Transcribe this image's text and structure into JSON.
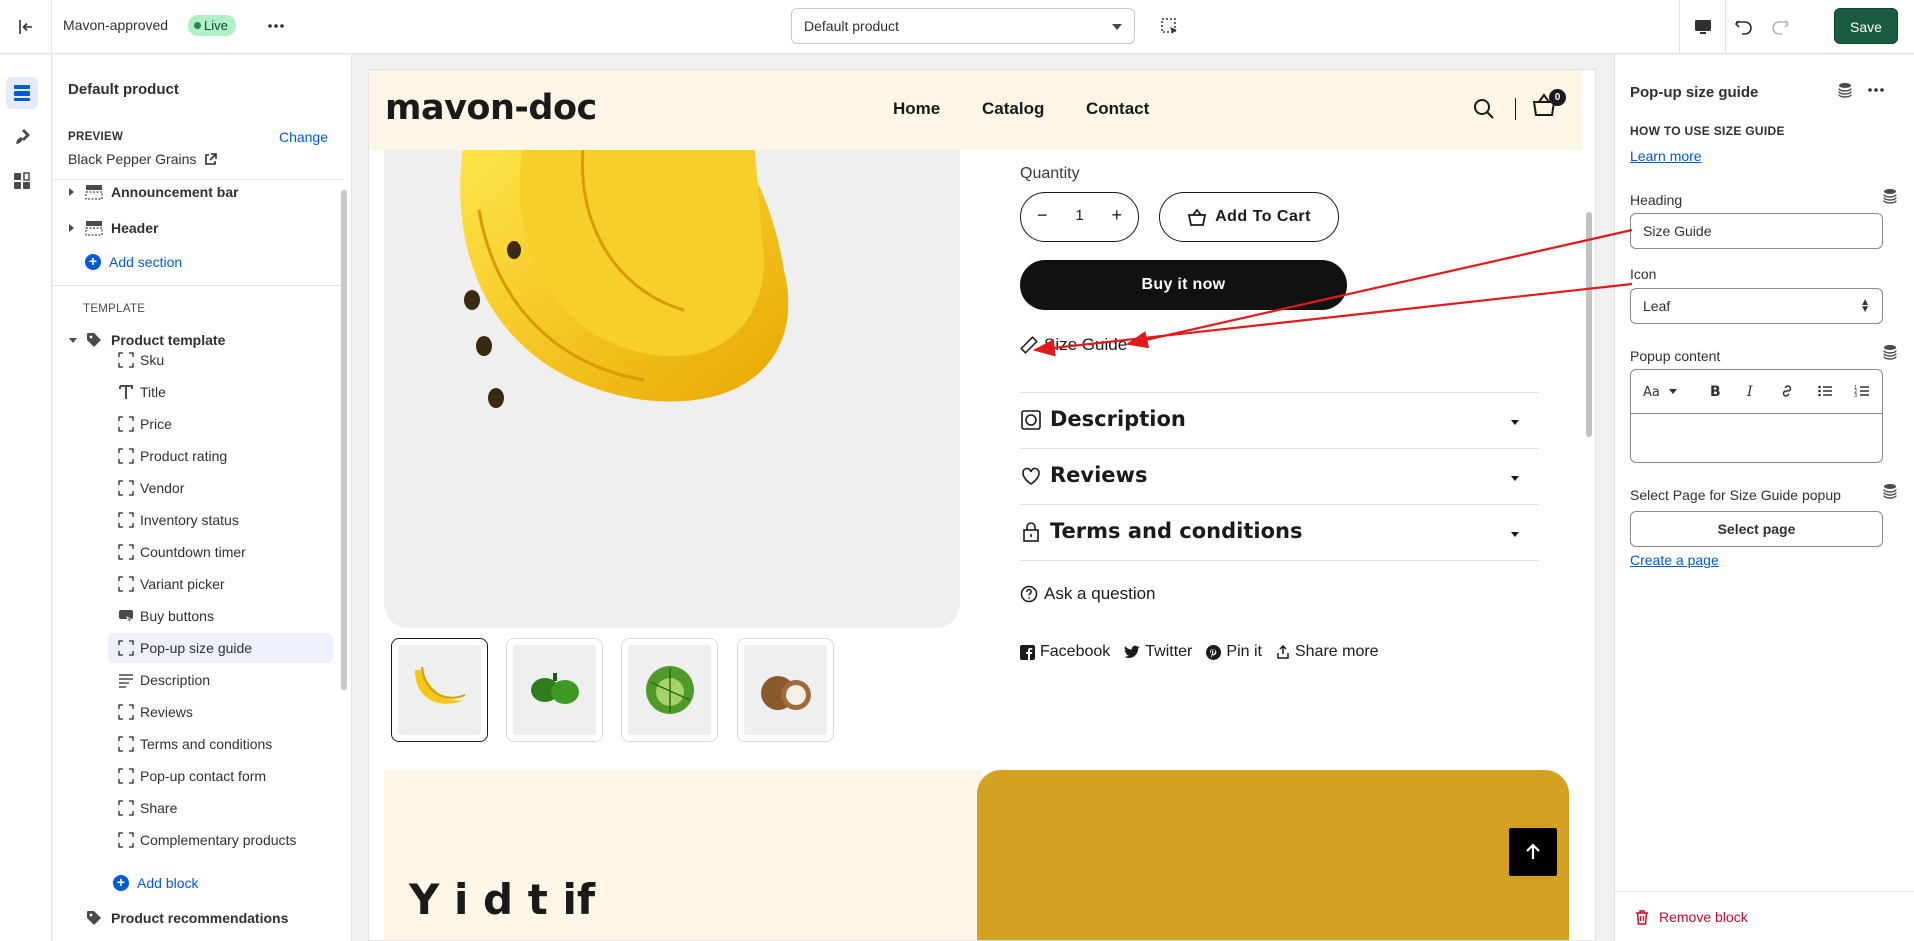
{
  "topbar": {
    "store_name": "Mavon-approved",
    "live_badge": "Live",
    "template_select_value": "Default product",
    "save_label": "Save"
  },
  "left_panel": {
    "title": "Default product",
    "preview_label": "PREVIEW",
    "change_label": "Change",
    "preview_value": "Black Pepper Grains",
    "sections_top": [
      {
        "label": "Announcement bar"
      },
      {
        "label": "Header"
      }
    ],
    "add_section_label": "Add section",
    "template_label": "TEMPLATE",
    "product_template_label": "Product template",
    "blocks": [
      {
        "label": "Sku",
        "icon": "block-frame-icon"
      },
      {
        "label": "Title",
        "icon": "title-t-icon"
      },
      {
        "label": "Price",
        "icon": "block-frame-icon"
      },
      {
        "label": "Product rating",
        "icon": "block-frame-icon"
      },
      {
        "label": "Vendor",
        "icon": "block-frame-icon"
      },
      {
        "label": "Inventory status",
        "icon": "block-frame-icon"
      },
      {
        "label": "Countdown timer",
        "icon": "block-frame-icon"
      },
      {
        "label": "Variant picker",
        "icon": "block-frame-icon"
      },
      {
        "label": "Buy buttons",
        "icon": "buy-buttons-icon"
      },
      {
        "label": "Pop-up size guide",
        "icon": "block-frame-icon",
        "selected": true
      },
      {
        "label": "Description",
        "icon": "text-lines-icon"
      },
      {
        "label": "Reviews",
        "icon": "block-frame-icon"
      },
      {
        "label": "Terms and conditions",
        "icon": "block-frame-icon"
      },
      {
        "label": "Pop-up contact form",
        "icon": "block-frame-icon"
      },
      {
        "label": "Share",
        "icon": "block-frame-icon"
      },
      {
        "label": "Complementary products",
        "icon": "block-frame-icon"
      }
    ],
    "add_block_label": "Add block",
    "product_recommendations_label": "Product recommendations"
  },
  "preview": {
    "logo": "mavon-doc",
    "nav": [
      "Home",
      "Catalog",
      "Contact"
    ],
    "cart_count": "0",
    "quantity_label": "Quantity",
    "quantity_value": "1",
    "qty_minus": "−",
    "qty_plus": "+",
    "add_to_cart": "Add To Cart",
    "buy_now": "Buy it now",
    "size_guide": "Size Guide",
    "accordions": [
      {
        "title": "Description",
        "icon": "box-icon"
      },
      {
        "title": "Reviews",
        "icon": "heart-icon"
      },
      {
        "title": "Terms and conditions",
        "icon": "lock-icon"
      }
    ],
    "ask_question": "Ask a question",
    "share": [
      {
        "label": "Facebook",
        "icon": "facebook-icon"
      },
      {
        "label": "Twitter",
        "icon": "twitter-icon"
      },
      {
        "label": "Pin it",
        "icon": "pinterest-icon"
      },
      {
        "label": "Share more",
        "icon": "share-icon"
      }
    ],
    "thumbnails": [
      "banana",
      "peppers",
      "cabbage",
      "coconut"
    ],
    "promo_text": "Y    i    d  t  if"
  },
  "right_panel": {
    "title": "Pop-up size guide",
    "how_to_label": "HOW TO USE SIZE GUIDE",
    "learn_more": "Learn more",
    "heading_label": "Heading",
    "heading_value": "Size Guide",
    "icon_label": "Icon",
    "icon_value": "Leaf",
    "popup_content_label": "Popup content",
    "select_page_label": "Select Page for Size Guide popup",
    "select_page_button": "Select page",
    "create_page": "Create a page",
    "remove_block": "Remove block"
  },
  "colors": {
    "accent_blue": "#005bd3",
    "save_green": "#1a5c3f",
    "annotation_red": "#e01b1b",
    "site_header_bg": "#fdf5e6",
    "promo_gold": "#d4a123"
  }
}
